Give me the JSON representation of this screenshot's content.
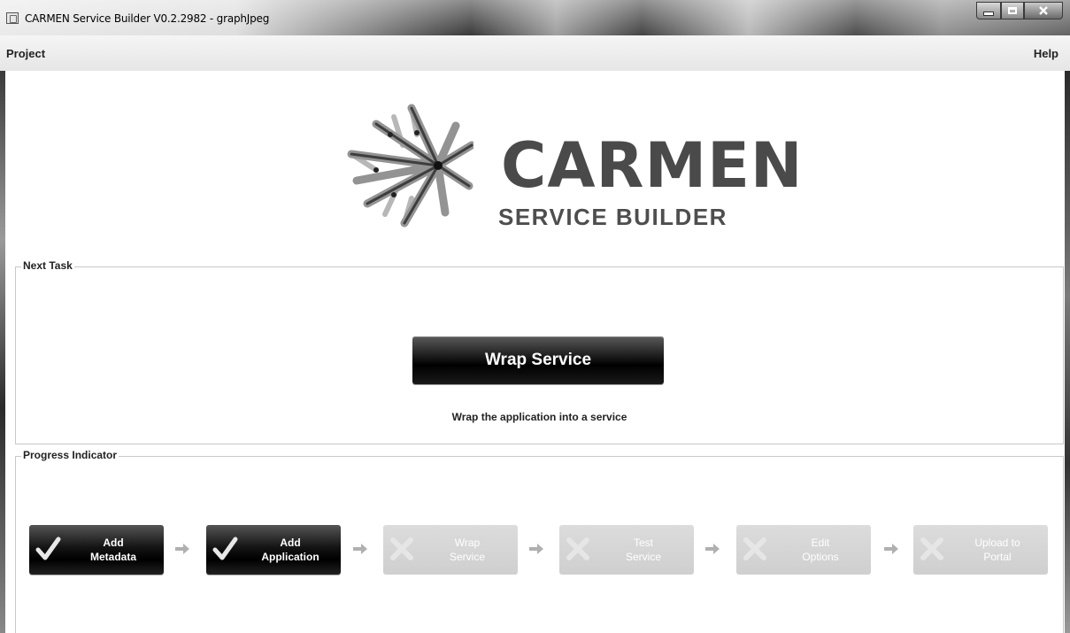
{
  "window": {
    "title": "CARMEN Service Builder V0.2.2982  - graphJpeg"
  },
  "menu": {
    "project": "Project",
    "help": "Help"
  },
  "logo": {
    "title": "CARMEN",
    "subtitle": "SERVICE BUILDER"
  },
  "next_task": {
    "group_label": "Next Task",
    "button_label": "Wrap Service",
    "description": "Wrap the application into a service"
  },
  "progress": {
    "group_label": "Progress Indicator",
    "steps": [
      {
        "label": "Add\nMetadata",
        "status": "done",
        "icon": "check-icon"
      },
      {
        "label": "Add\nApplication",
        "status": "done",
        "icon": "check-icon"
      },
      {
        "label": "Wrap\nService",
        "status": "pending",
        "icon": "cross-icon"
      },
      {
        "label": "Test\nService",
        "status": "pending",
        "icon": "cross-icon"
      },
      {
        "label": "Edit\nOptions",
        "status": "pending",
        "icon": "cross-icon"
      },
      {
        "label": "Upload to\nPortal",
        "status": "pending",
        "icon": "cross-icon"
      }
    ]
  },
  "colors": {
    "done_step": "#000000",
    "pending_step": "#d4d4d4",
    "arrow": "#b0b0b0"
  }
}
